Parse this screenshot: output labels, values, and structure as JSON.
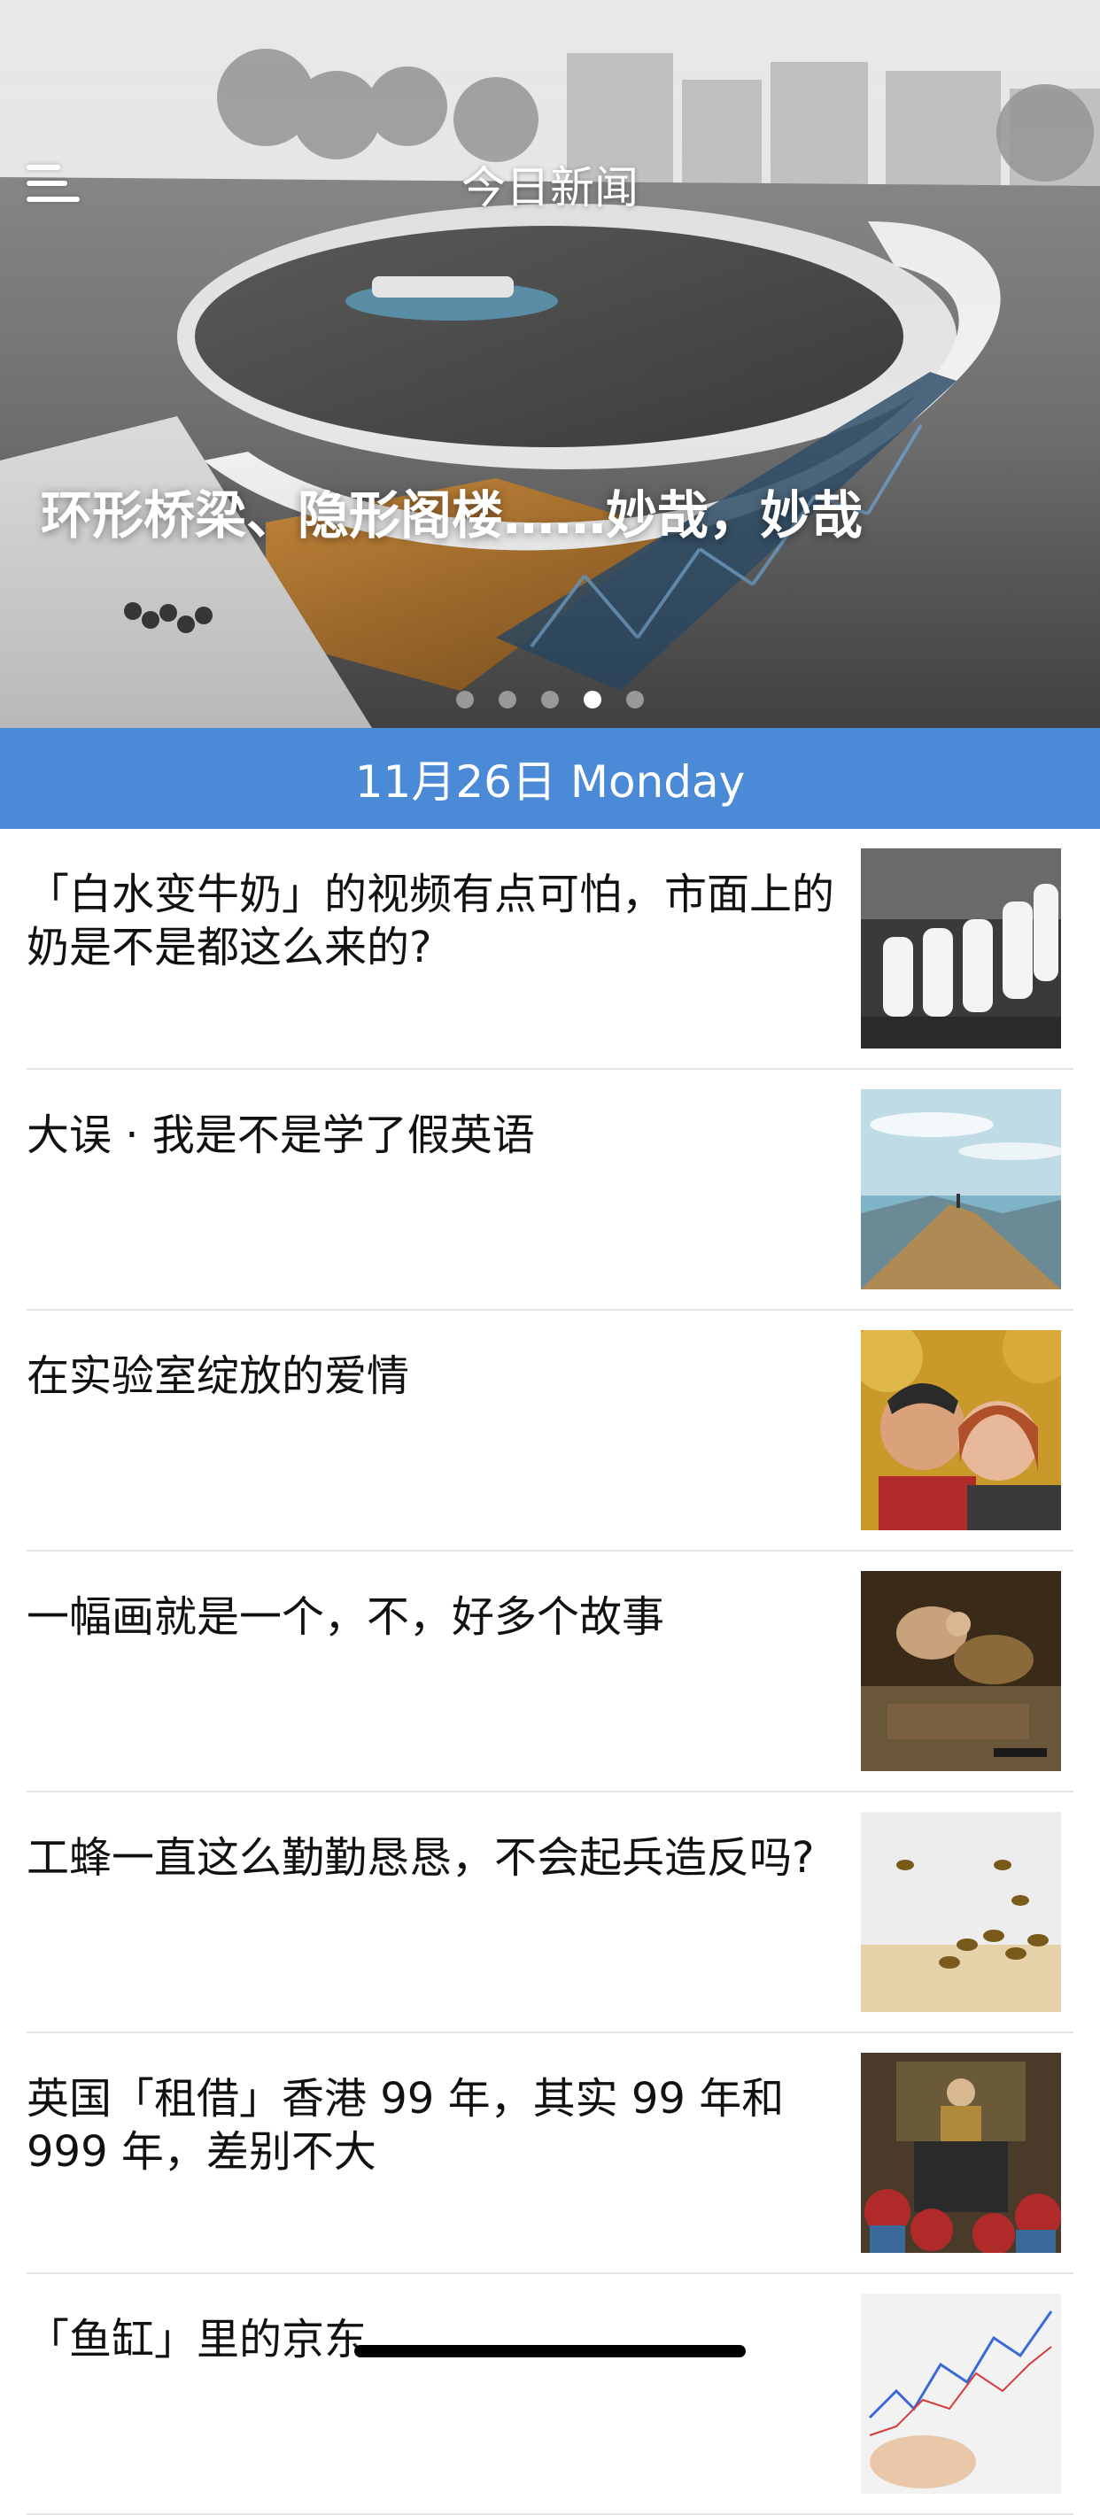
{
  "header": {
    "title": "今日新闻",
    "menu_icon": "hamburger-menu-icon"
  },
  "hero": {
    "headline": "环形桥梁、隐形阁楼……妙哉，妙哉",
    "image": "circular-bridge-photo",
    "slides": 5,
    "active_slide": 4
  },
  "date_bar": {
    "label": "11月26日 Monday"
  },
  "news": [
    {
      "title": "「白水变牛奶」的视频有点可怕，市面上的奶是不是都这么来的?",
      "thumb": "milk-bottles-photo"
    },
    {
      "title": "大误 · 我是不是学了假英语",
      "thumb": "mountain-ridge-photo"
    },
    {
      "title": "在实验室绽放的爱情",
      "thumb": "couple-selfie-photo"
    },
    {
      "title": "一幅画就是一个，不，好多个故事",
      "thumb": "classical-painting-photo"
    },
    {
      "title": "工蜂一直这么勤勤恳恳，不会起兵造反吗?",
      "thumb": "bees-photo"
    },
    {
      "title": "英国「租借」香港 99 年，其实 99 年和 999 年，差别不大",
      "thumb": "qing-court-painting-photo"
    },
    {
      "title": "「鱼缸」里的京东",
      "thumb": "stock-chart-photo"
    }
  ],
  "colors": {
    "accent": "#4a8ad6",
    "divider": "#e3e3e3",
    "text": "#111111"
  }
}
